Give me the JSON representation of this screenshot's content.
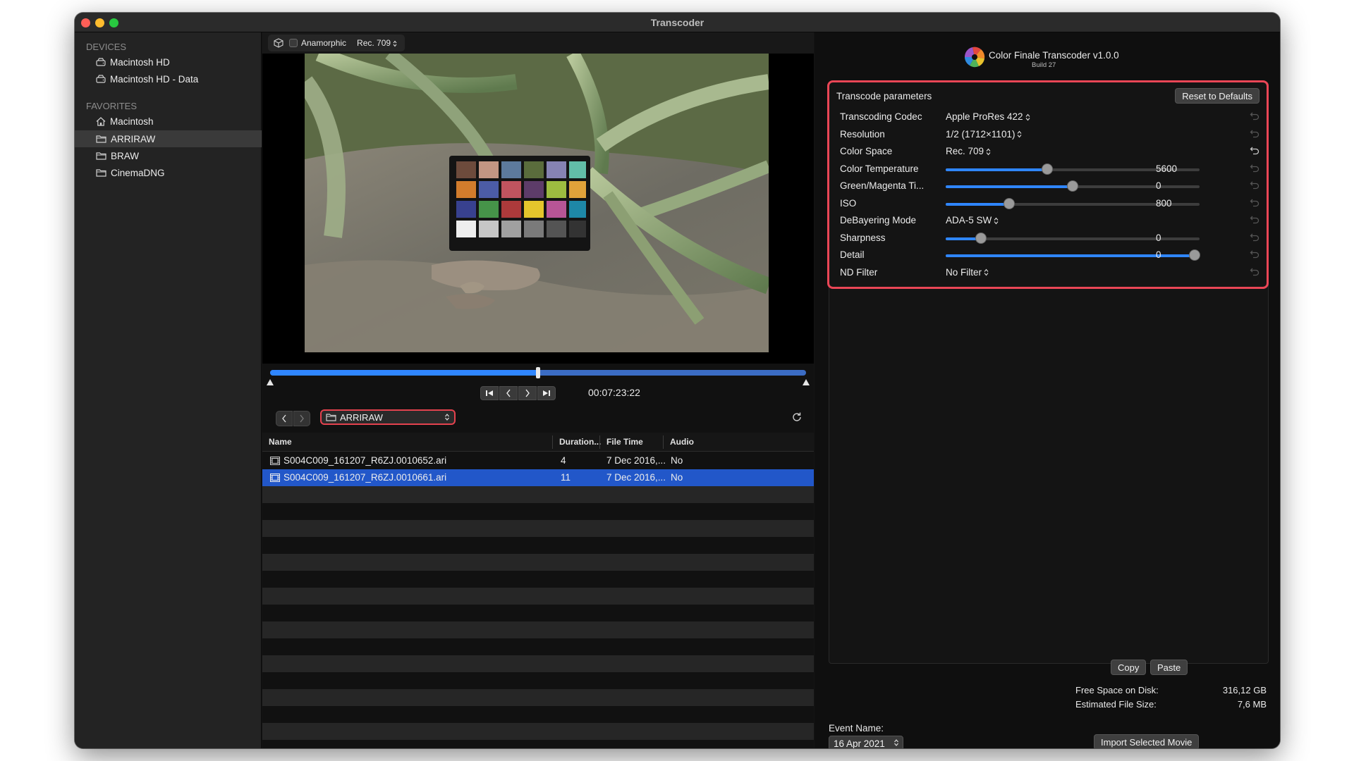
{
  "window": {
    "title": "Transcoder"
  },
  "sidebar": {
    "devices_header": "DEVICES",
    "devices": [
      {
        "label": "Macintosh HD",
        "icon": "drive-icon"
      },
      {
        "label": "Macintosh HD - Data",
        "icon": "drive-icon"
      }
    ],
    "favorites_header": "FAVORITES",
    "favorites": [
      {
        "label": "Macintosh",
        "icon": "home-icon"
      },
      {
        "label": "ARRIRAW",
        "icon": "folder-icon",
        "selected": true
      },
      {
        "label": "BRAW",
        "icon": "folder-icon"
      },
      {
        "label": "CinemaDNG",
        "icon": "folder-icon"
      }
    ]
  },
  "viewer": {
    "anamorphic_label": "Anamorphic",
    "anamorphic_checked": false,
    "color_space": "Rec. 709",
    "playhead_fraction": 0.5,
    "timecode": "00:07:23:22"
  },
  "browser": {
    "path": "ARRIRAW",
    "columns": [
      "Name",
      "Duration...",
      "File Time",
      "Audio"
    ],
    "files": [
      {
        "name": "S004C009_161207_R6ZJ.0010652.ari",
        "duration": "4",
        "file_time": "7 Dec 2016,...",
        "audio": "No",
        "selected": false
      },
      {
        "name": "S004C009_161207_R6ZJ.0010661.ari",
        "duration": "11",
        "file_time": "7 Dec 2016,...",
        "audio": "No",
        "selected": true
      }
    ]
  },
  "app": {
    "name": "Color Finale Transcoder v1.0.0",
    "build": "Build 27"
  },
  "params": {
    "title": "Transcode parameters",
    "reset_label": "Reset to Defaults",
    "rows": [
      {
        "label": "Transcoding Codec",
        "value": "Apple ProRes 422",
        "kind": "select"
      },
      {
        "label": "Resolution",
        "value": "1/2 (1712×1101)",
        "kind": "select"
      },
      {
        "label": "Color Space",
        "value": "Rec. 709",
        "kind": "select"
      },
      {
        "label": "Color Temperature",
        "value": "5600",
        "kind": "slider",
        "level": 0.4
      },
      {
        "label": "Green/Magenta Ti...",
        "value": "0",
        "kind": "slider",
        "level": 0.5
      },
      {
        "label": "ISO",
        "value": "800",
        "kind": "slider",
        "level": 0.25
      },
      {
        "label": "DeBayering Mode",
        "value": "ADA-5 SW",
        "kind": "select"
      },
      {
        "label": "Sharpness",
        "value": "0",
        "kind": "slider",
        "level": 0.14
      },
      {
        "label": "Detail",
        "value": "0",
        "kind": "slider",
        "level": 0.98
      },
      {
        "label": "ND Filter",
        "value": "No Filter",
        "kind": "select"
      }
    ]
  },
  "actions": {
    "copy": "Copy",
    "paste": "Paste",
    "import": "Import Selected Movie"
  },
  "disk": {
    "free_label": "Free Space on Disk:",
    "free_value": "316,12 GB",
    "est_label": "Estimated File Size:",
    "est_value": "7,6 MB"
  },
  "event": {
    "label": "Event Name:",
    "value": "16 Apr 2021"
  },
  "colors": {
    "accent": "#2f86ff",
    "highlight": "#e4424e",
    "selection": "#2257c9"
  }
}
